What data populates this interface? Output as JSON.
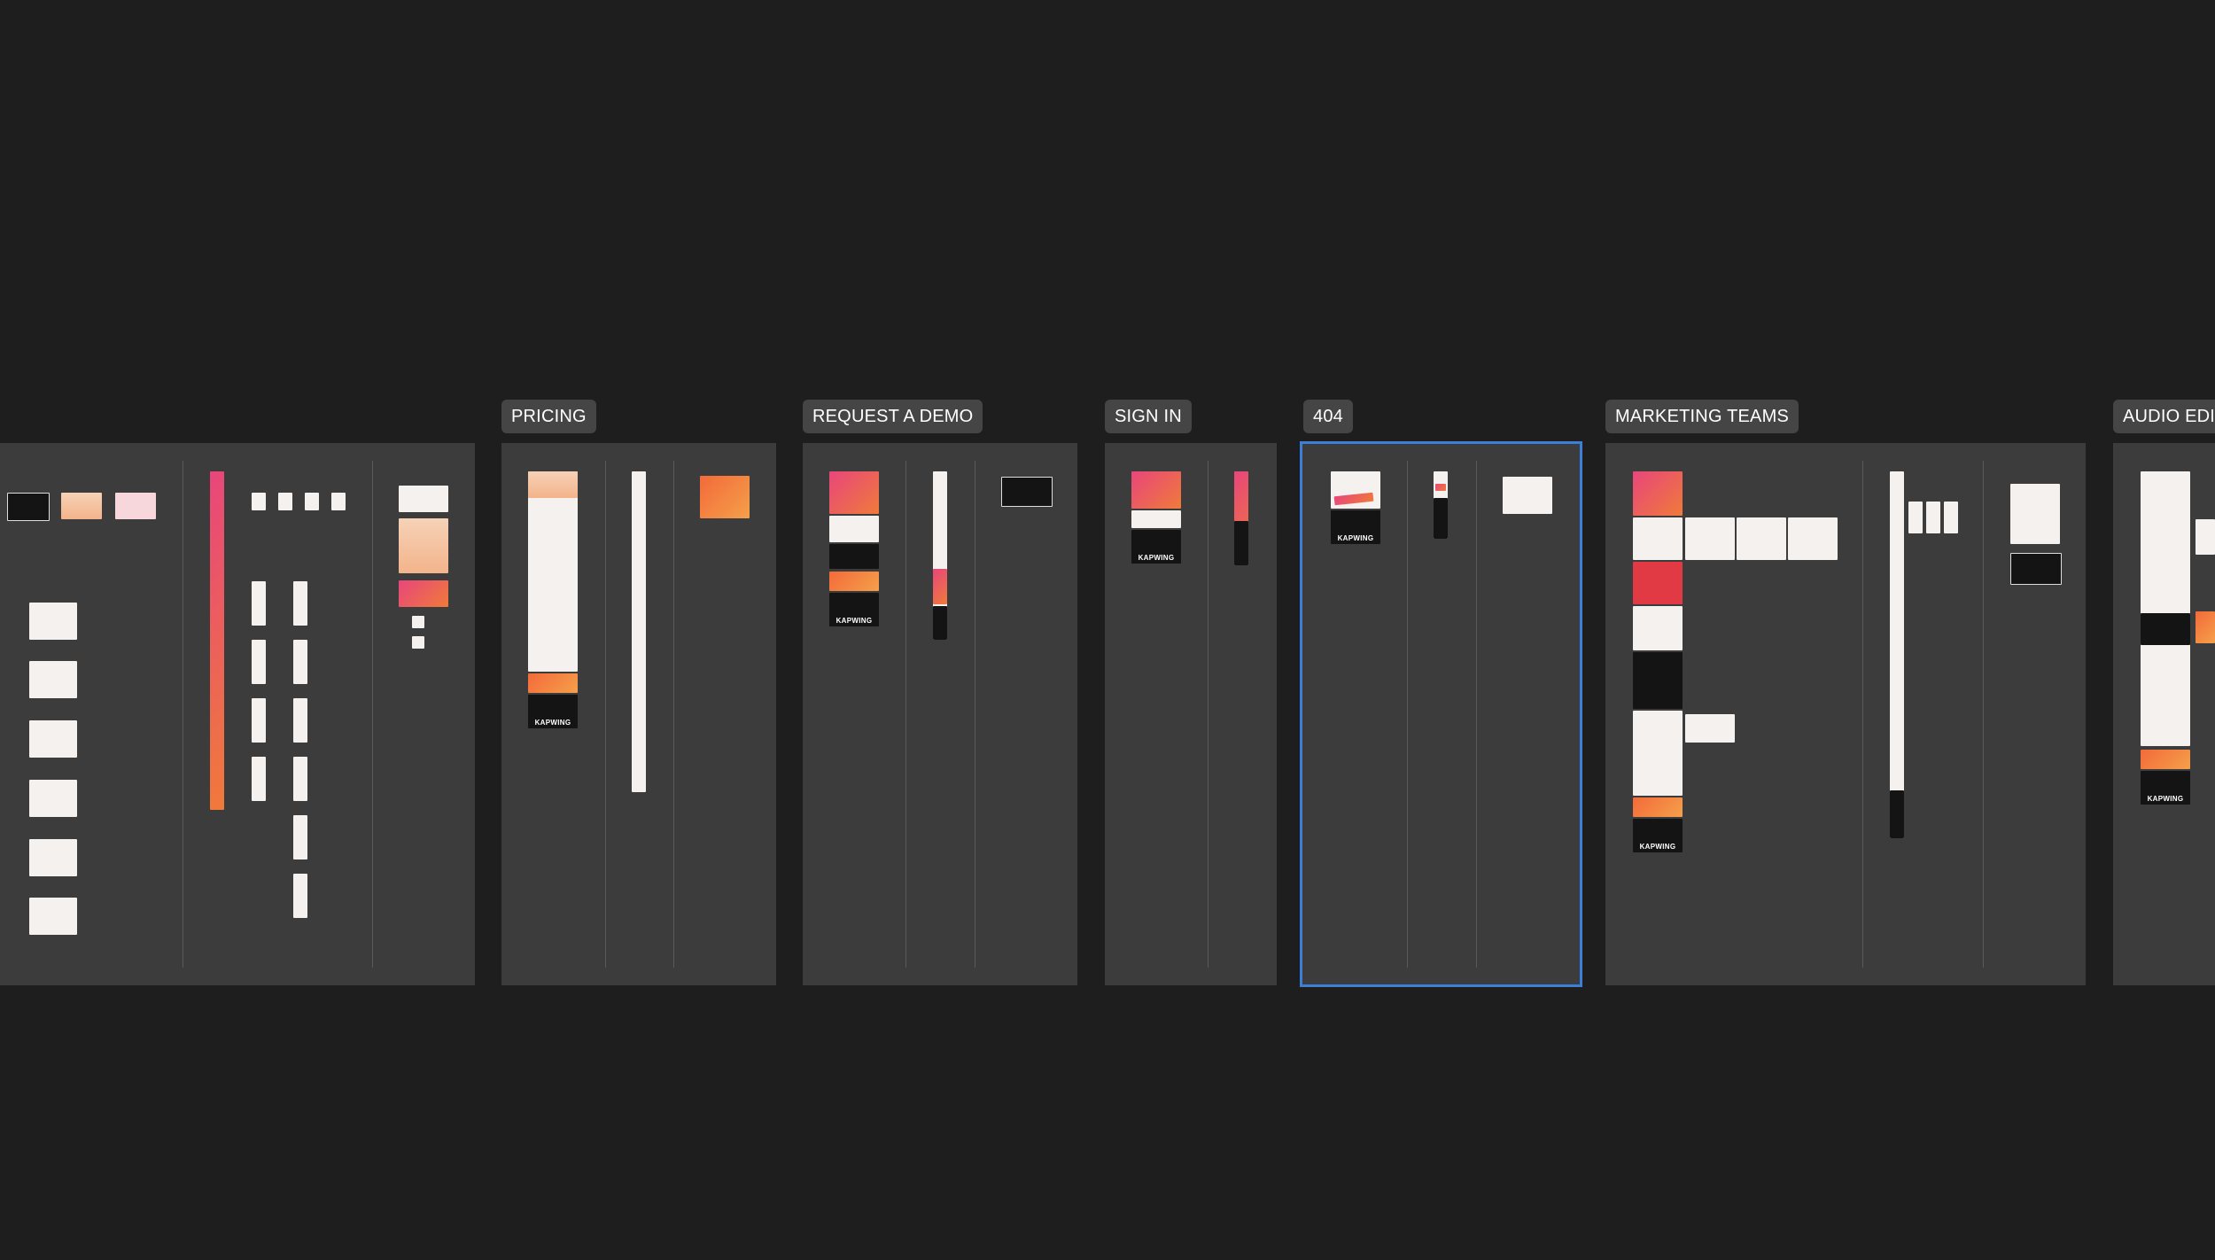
{
  "canvas": {
    "background": "#1e1e1e",
    "section_fill": "#3c3c3c",
    "selection_color": "#3d7fd6",
    "brand_wordmark": "KAPWING"
  },
  "sections": [
    {
      "id": "pricing",
      "label": "PRICING"
    },
    {
      "id": "request-demo",
      "label": "REQUEST A DEMO"
    },
    {
      "id": "sign-in",
      "label": "SIGN IN"
    },
    {
      "id": "not-found",
      "label": "404",
      "selected": true
    },
    {
      "id": "marketing-teams",
      "label": "MARKETING TEAMS"
    },
    {
      "id": "audio-editor",
      "label": "AUDIO EDIT"
    }
  ]
}
